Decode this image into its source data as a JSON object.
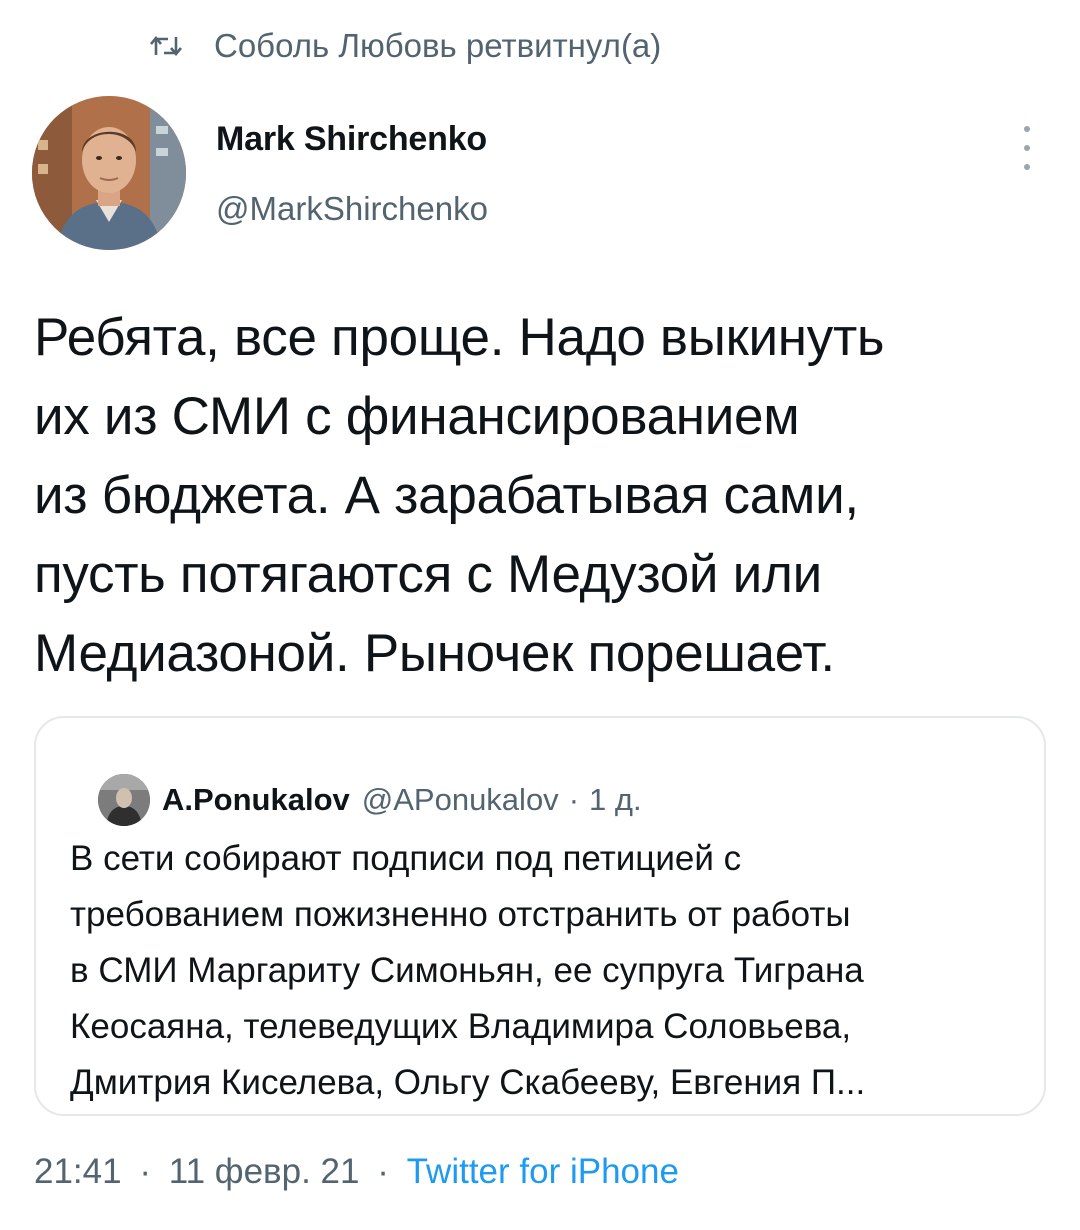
{
  "retweet": {
    "icon": "retweet-icon",
    "text": "Соболь Любовь ретвитнул(а)"
  },
  "author": {
    "name": "Mark Shirchenko",
    "handle": "@MarkShirchenko"
  },
  "tweet": {
    "lines": [
      "Ребята, все проще. Надо выкинуть",
      "их из СМИ с финансированием",
      "из бюджета. А зарабатывая сами,",
      "пусть потягаются с Медузой или",
      "Медиазоной. Рыночек порешает."
    ]
  },
  "quote": {
    "name": "A.Ponukalov",
    "handle": "@APonukalov",
    "separator": "·",
    "age": "1 д.",
    "lines": [
      "В сети собирают подписи под петицией с",
      "требованием пожизненно отстранить от работы",
      "в СМИ Маргариту Симоньян, ее супруга Тиграна",
      "Кеосаяна, телеведущих Владимира Соловьева,",
      "Дмитрия Киселева, Ольгу Скабееву, Евгения П..."
    ]
  },
  "footer": {
    "time": "21:41",
    "sep1": "·",
    "date": "11 февр. 21",
    "sep2": "·",
    "source": "Twitter for iPhone"
  },
  "colors": {
    "text_primary": "#0f1419",
    "text_secondary": "#536471",
    "link": "#1d9bf0",
    "border": "#e4e8eb"
  }
}
